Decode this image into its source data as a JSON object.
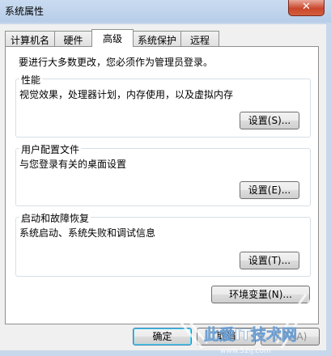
{
  "window": {
    "title": "系统属性",
    "close_glyph": "✕"
  },
  "tabs": [
    {
      "label": "计算机名"
    },
    {
      "label": "硬件"
    },
    {
      "label": "高级"
    },
    {
      "label": "系统保护"
    },
    {
      "label": "远程"
    }
  ],
  "active_tab": "高级",
  "intro_text": "要进行大多数更改，您必须作为管理员登录。",
  "performance": {
    "label": "性能",
    "description": "视觉效果，处理器计划，内存使用，以及虚拟内存",
    "button": "设置(S)..."
  },
  "profiles": {
    "label": "用户配置文件",
    "description": "与您登录有关的桌面设置",
    "button": "设置(E)..."
  },
  "startup": {
    "label": "启动和故障恢复",
    "description": "系统启动、系统失败和调试信息",
    "button": "设置(T)..."
  },
  "env_button": "环境变量(N)...",
  "footer": {
    "ok": "确定",
    "cancel": "取消",
    "apply": "应用(A)"
  },
  "watermark": {
    "text": "此爱IT技术网",
    "url": "www.52ij.com"
  }
}
